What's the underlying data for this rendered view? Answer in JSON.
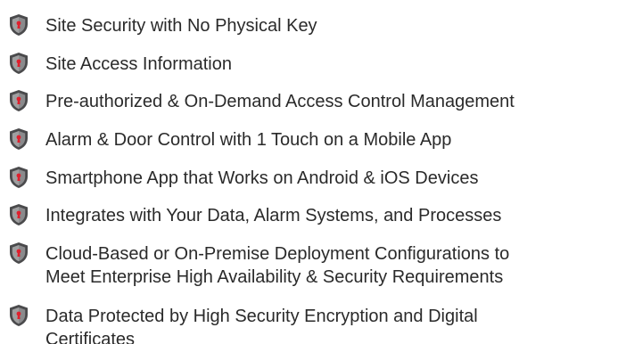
{
  "colors": {
    "shield_outer": "#4a4a4c",
    "shield_inner": "#8a8a8c",
    "keyhole": "#e01f2d",
    "text": "#2a2a2a"
  },
  "icons": {
    "bullet": "shield-keyhole-icon"
  },
  "features": [
    {
      "lines": [
        "Site Security with No Physical Key"
      ]
    },
    {
      "lines": [
        "Site Access Information"
      ]
    },
    {
      "lines": [
        "Pre-authorized & On-Demand Access Control Management"
      ]
    },
    {
      "lines": [
        "Alarm & Door Control with 1 Touch on a Mobile App"
      ]
    },
    {
      "lines": [
        "Smartphone App that Works on Android & iOS Devices"
      ]
    },
    {
      "lines": [
        "Integrates with Your Data, Alarm Systems, and Processes"
      ]
    },
    {
      "lines": [
        "Cloud-Based or On-Premise Deployment Configurations to",
        "Meet Enterprise High Availability & Security Requirements"
      ]
    },
    {
      "lines": [
        "Data Protected by High Security Encryption and Digital",
        "Certificates"
      ]
    }
  ]
}
